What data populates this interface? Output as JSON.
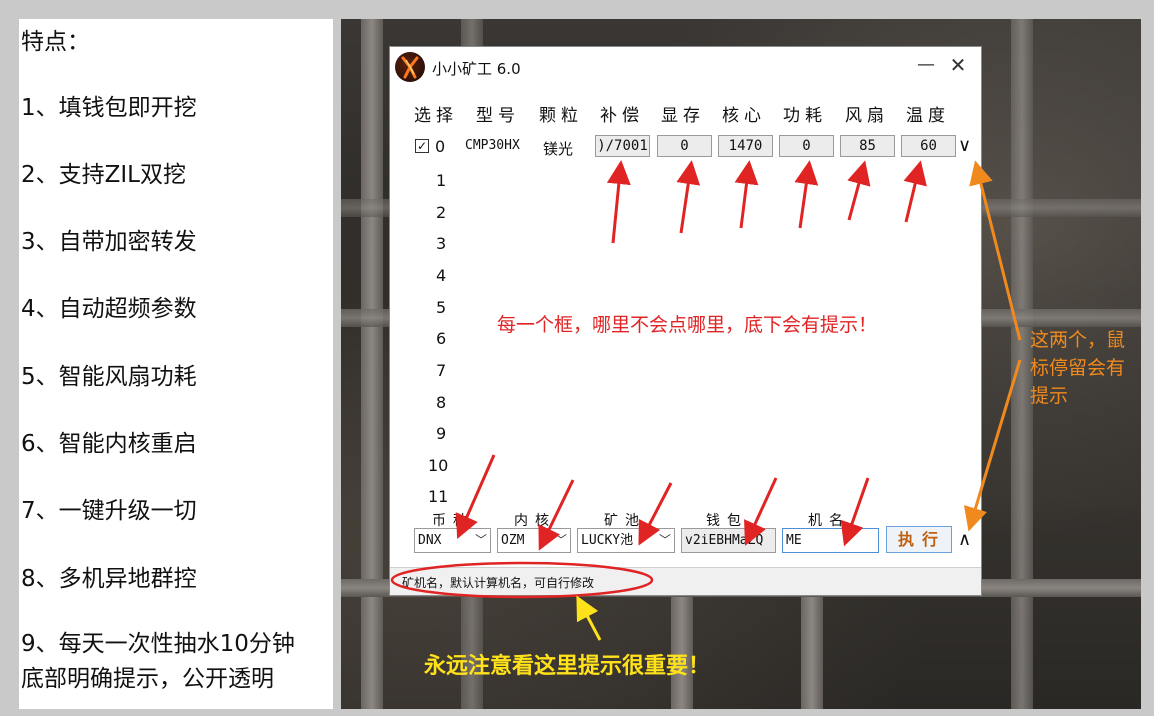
{
  "features": {
    "heading": "特点：",
    "items": [
      "1、填钱包即开挖",
      "2、支持ZIL双挖",
      "3、自带加密转发",
      "4、自动超频参数",
      "5、智能风扇功耗",
      "6、智能内核重启",
      "7、一键升级一切",
      "8、多机异地群控",
      "9、每天一次性抽水10分钟",
      "底部明确提示，公开透明"
    ]
  },
  "window": {
    "title": "小小矿工 6.0",
    "minimize": "—",
    "close": "✕",
    "headers": [
      "选择",
      "型号",
      "颗粒",
      "补偿",
      "显存",
      "核心",
      "功耗",
      "风扇",
      "温度"
    ],
    "row0": {
      "checked": true,
      "index": "0",
      "model": "CMP30HX",
      "memory_type": "镁光",
      "compensation": ")/7001",
      "vram": "0",
      "core": "1470",
      "power": "0",
      "fan": "85",
      "temp": "60"
    },
    "row_numbers": [
      "1",
      "2",
      "3",
      "4",
      "5",
      "6",
      "7",
      "8",
      "9",
      "10",
      "11"
    ],
    "bottom_labels": {
      "coin": "币种",
      "kernel": "内核",
      "pool": "矿池",
      "wallet": "钱包",
      "machine": "机名"
    },
    "coin_value": "DNX",
    "kernel_value": "OZM",
    "pool_value": "LUCKY池",
    "wallet_value": "v2iEBHMaZQ",
    "machine_value": "ME",
    "exec_label": "执行",
    "chevron_up": "∧",
    "chevron_down": "∨",
    "status": "矿机名，默认计算机名，可自行修改"
  },
  "annotations": {
    "red": "每一个框，哪里不会点哪里，底下会有提示！",
    "orange": "这两个，鼠标停留会有提示",
    "yellow": "永远注意看这里提示很重要！"
  },
  "colors": {
    "red": "#e02424",
    "orange": "#f08a1e",
    "yellow": "#ffe21a",
    "exec_text": "#c06010"
  }
}
